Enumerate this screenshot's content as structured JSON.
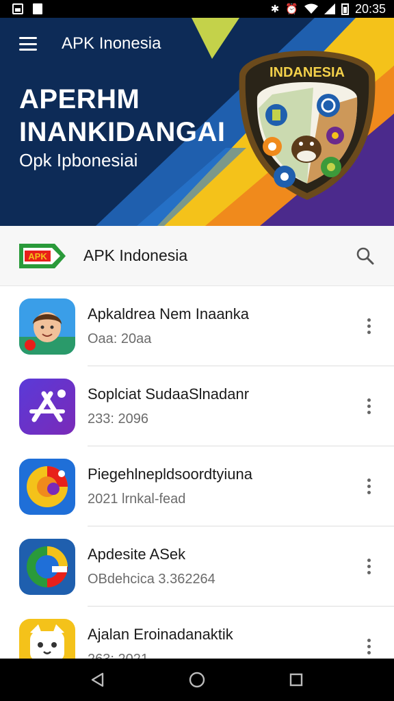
{
  "status_bar": {
    "time": "20:35",
    "icons": [
      "image-icon",
      "file-icon",
      "bluetooth-icon",
      "alarm-icon",
      "wifi-icon",
      "signal-icon",
      "battery-icon"
    ]
  },
  "hero": {
    "app_title": "APK Inonesia",
    "headline_line1": "APERHM",
    "headline_line2": "INANKIDANGAI",
    "subtitle": "Opk Ipbonesiai",
    "badge_text": "INDANESIA",
    "colors": {
      "navy": "#0d2b57",
      "blue": "#1f5fae",
      "yellow": "#f4c21a",
      "orange": "#f08a1c",
      "purple": "#4b2a8c",
      "green": "#c4d24a"
    }
  },
  "header": {
    "logo_text": "APK",
    "title": "APK Indonesia"
  },
  "apps": [
    {
      "title": "Apkaldrea Nem Inaanka",
      "subtitle": "Oaa: 20aa",
      "icon": "boy-avatar-icon"
    },
    {
      "title": "Soplciat SudaaSlnadanr",
      "subtitle": "233: 2096",
      "icon": "app-store-icon"
    },
    {
      "title": "Piegehlnepldsoordtyiuna",
      "subtitle": "2021 lrnkal-fead",
      "icon": "chrome-like-icon"
    },
    {
      "title": "Apdesite ASek",
      "subtitle": "OBdehcica   3.362264",
      "icon": "globe-icon"
    },
    {
      "title": "Ajalan Eroinadanaktik",
      "subtitle": "263: 2021",
      "icon": "cat-icon"
    }
  ],
  "nav": {
    "icons": [
      "back-icon",
      "home-icon",
      "recents-icon"
    ]
  }
}
